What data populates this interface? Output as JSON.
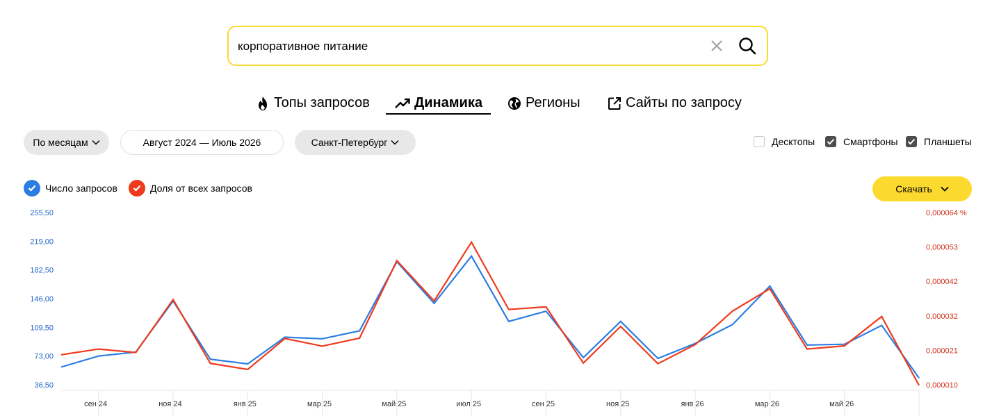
{
  "search": {
    "query": "корпоративное питание"
  },
  "tabs": [
    {
      "label": "Топы запросов",
      "icon": "flame-icon",
      "active": false
    },
    {
      "label": "Динамика",
      "icon": "trend-up-icon",
      "active": true
    },
    {
      "label": "Регионы",
      "icon": "globe-icon",
      "active": false
    },
    {
      "label": "Сайты по запросу",
      "icon": "external-link-icon",
      "active": false
    }
  ],
  "filters": {
    "period_grouping": "По месяцам",
    "date_range": "Август 2024 — Июль 2026",
    "region": "Санкт-Петербург"
  },
  "devices": [
    {
      "label": "Десктопы",
      "checked": false
    },
    {
      "label": "Смартфоны",
      "checked": true
    },
    {
      "label": "Планшеты",
      "checked": true
    }
  ],
  "legend": [
    {
      "label": "Число запросов",
      "color": "#2a7de1",
      "checked": true
    },
    {
      "label": "Доля от всех запросов",
      "color": "#ef3a1d",
      "checked": true
    }
  ],
  "download_label": "Скачать",
  "colors": {
    "accent_yellow": "#fcd92f",
    "series_blue": "#2a7de1",
    "series_red": "#ef3a1d",
    "grid": "#e5e5e5",
    "axis_left": "#1f63c5",
    "axis_right": "#d0301a"
  },
  "chart_data": {
    "type": "line",
    "x": [
      "авг 24",
      "сен 24",
      "окт 24",
      "ноя 24",
      "дек 24",
      "янв 25",
      "фев 25",
      "мар 25",
      "апр 25",
      "май 25",
      "июн 25",
      "июл 25",
      "авг 25",
      "сен 25",
      "окт 25",
      "ноя 25",
      "дек 25",
      "янв 26",
      "фев 26",
      "мар 26",
      "апр 26",
      "май 26",
      "июн 26",
      "июл 26"
    ],
    "x_tick_labels": [
      "сен 24",
      "ноя 24",
      "янв 25",
      "мар 25",
      "май 25",
      "июл 25",
      "сен 25",
      "ноя 25",
      "янв 26",
      "мар 26",
      "май 26"
    ],
    "y_left_ticks": [
      "255,50",
      "219,00",
      "182,50",
      "146,00",
      "109,50",
      "73,00",
      "36,50"
    ],
    "y_right_ticks": [
      "0,000064 %",
      "0,000053",
      "0,000042",
      "0,000032",
      "0,000021",
      "0,000010"
    ],
    "y_left_range": [
      36.5,
      255.5
    ],
    "y_right_range": [
      1e-05,
      6.4e-05
    ],
    "grid": true,
    "series": [
      {
        "name": "Число запросов",
        "axis": "left",
        "values": [
          59,
          73,
          78,
          143,
          69,
          63,
          97,
          95,
          105,
          193,
          140,
          200,
          117,
          130,
          71,
          117,
          70,
          89,
          113,
          162,
          87,
          88,
          112,
          45
        ]
      },
      {
        "name": "Доля от всех запросов",
        "axis": "right",
        "values": [
          1.94e-05,
          2.12e-05,
          2.01e-05,
          3.67e-05,
          1.67e-05,
          1.48e-05,
          2.45e-05,
          2.21e-05,
          2.46e-05,
          4.89e-05,
          3.63e-05,
          5.47e-05,
          3.36e-05,
          3.44e-05,
          1.68e-05,
          2.83e-05,
          1.66e-05,
          2.26e-05,
          3.31e-05,
          4.01e-05,
          2.12e-05,
          2.22e-05,
          3.14e-05,
          9.8e-06
        ]
      }
    ]
  }
}
